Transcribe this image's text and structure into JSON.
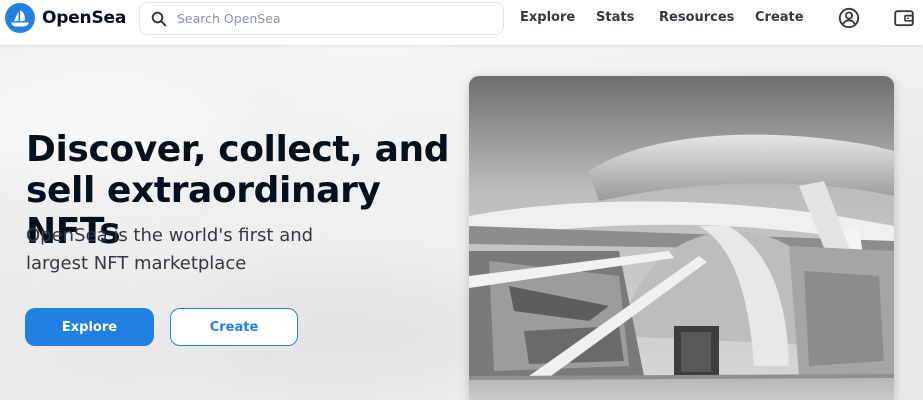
{
  "brand": {
    "name": "OpenSea",
    "accent": "#2081e2",
    "icon": "opensea-logo-icon"
  },
  "search": {
    "placeholder": "Search OpenSea",
    "value": "",
    "icon": "search-icon"
  },
  "nav": {
    "items": [
      {
        "label": "Explore"
      },
      {
        "label": "Stats"
      },
      {
        "label": "Resources"
      },
      {
        "label": "Create"
      }
    ],
    "icons": [
      "account-icon",
      "wallet-icon"
    ]
  },
  "hero": {
    "title_line1": "Discover, collect, and",
    "title_line2": "sell extraordinary NFTs",
    "subtitle_line1": "OpenSea is the world's first and",
    "subtitle_line2": "largest NFT marketplace",
    "explore_button": "Explore",
    "create_button": "Create"
  }
}
